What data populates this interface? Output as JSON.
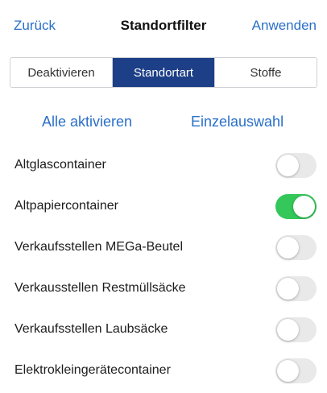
{
  "navbar": {
    "back_label": "Zurück",
    "title": "Standortfilter",
    "apply_label": "Anwenden"
  },
  "segments": [
    {
      "label": "Deaktivieren",
      "selected": false
    },
    {
      "label": "Standortart",
      "selected": true
    },
    {
      "label": "Stoffe",
      "selected": false
    }
  ],
  "actions": {
    "enable_all_label": "Alle aktivieren",
    "single_select_label": "Einzelauswahl"
  },
  "items": [
    {
      "label": "Altglascontainer",
      "enabled": false
    },
    {
      "label": "Altpapiercontainer",
      "enabled": true
    },
    {
      "label": "Verkaufsstellen MEGa-Beutel",
      "enabled": false
    },
    {
      "label": "Verkausstellen Restmüllsäcke",
      "enabled": false
    },
    {
      "label": "Verkaufsstellen Laubsäcke",
      "enabled": false
    },
    {
      "label": "Elektrokleingerätecontainer",
      "enabled": false
    }
  ],
  "colors": {
    "link": "#2a6fc9",
    "segment_selected_bg": "#1d3f87",
    "toggle_on": "#34c759",
    "toggle_off": "#e9e9ea"
  }
}
